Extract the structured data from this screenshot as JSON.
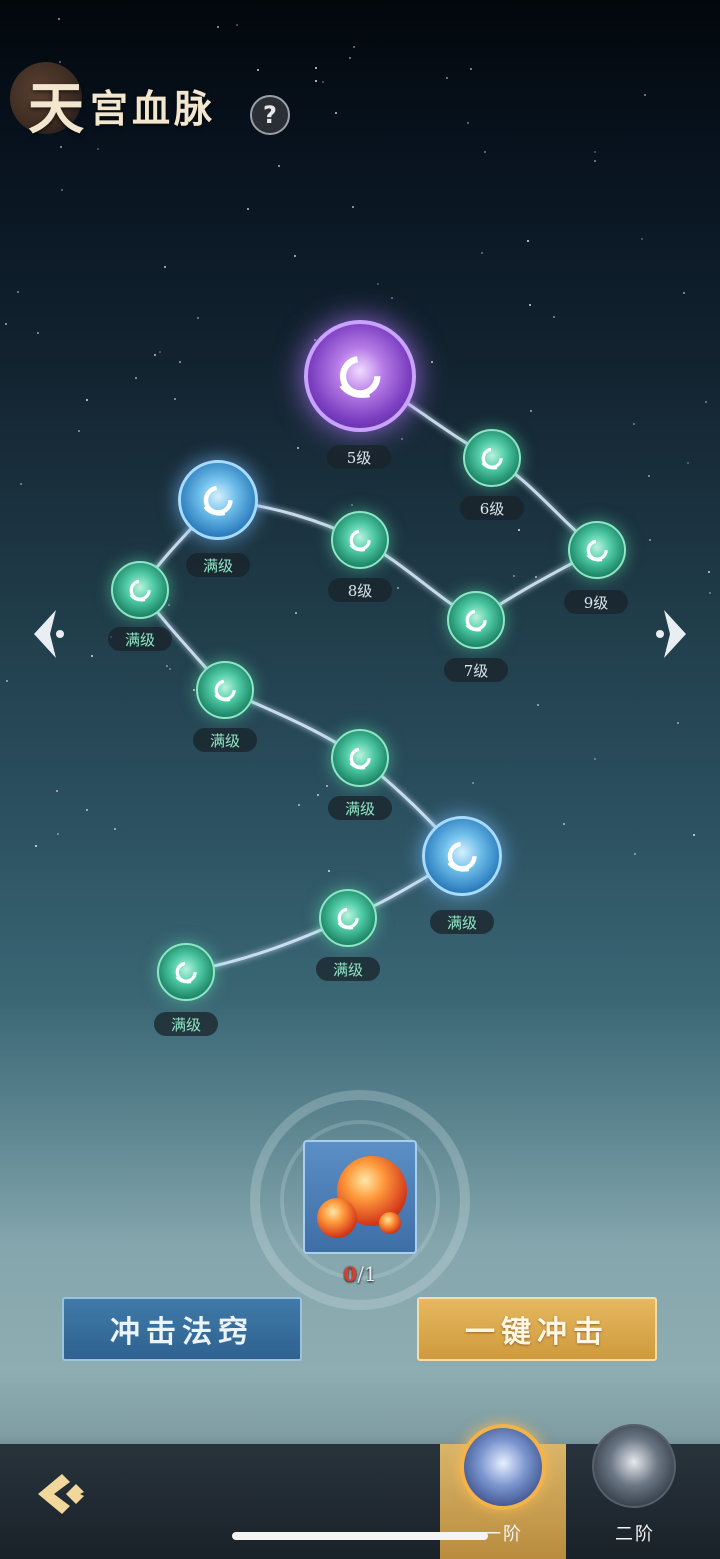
{
  "header": {
    "title_first_char": "天",
    "title_rest": "宫血脉",
    "help_label": "?"
  },
  "constellation": {
    "nodes": [
      {
        "id": "n5",
        "level_label": "5级",
        "kind": "purple"
      },
      {
        "id": "n6",
        "level_label": "6级",
        "kind": "green"
      },
      {
        "id": "n9",
        "level_label": "9级",
        "kind": "green"
      },
      {
        "id": "n7",
        "level_label": "7级",
        "kind": "green"
      },
      {
        "id": "n8",
        "level_label": "8级",
        "kind": "green"
      },
      {
        "id": "nb1",
        "level_label": "满级",
        "kind": "blue"
      },
      {
        "id": "ng1",
        "level_label": "满级",
        "kind": "green"
      },
      {
        "id": "ng2",
        "level_label": "满级",
        "kind": "green"
      },
      {
        "id": "ng3",
        "level_label": "满级",
        "kind": "green"
      },
      {
        "id": "nb2",
        "level_label": "满级",
        "kind": "blue"
      },
      {
        "id": "ng4",
        "level_label": "满级",
        "kind": "green"
      },
      {
        "id": "ng5",
        "level_label": "满级",
        "kind": "green"
      }
    ]
  },
  "item": {
    "have": "0",
    "separator": "/",
    "need": "1",
    "icon": "fire-orb-icon"
  },
  "actions": {
    "impact_label": "冲击法窍",
    "oneclick_label": "一键冲击"
  },
  "tabs": {
    "tier1_label": "一阶",
    "tier2_label": "二阶"
  },
  "colors": {
    "node_green": "#4fcaa4",
    "node_blue": "#6bbbe8",
    "node_purple": "#b67be6",
    "button_blue": "#3f7aa8",
    "button_gold": "#e6b85f",
    "item_count_zero": "#d8402c"
  }
}
